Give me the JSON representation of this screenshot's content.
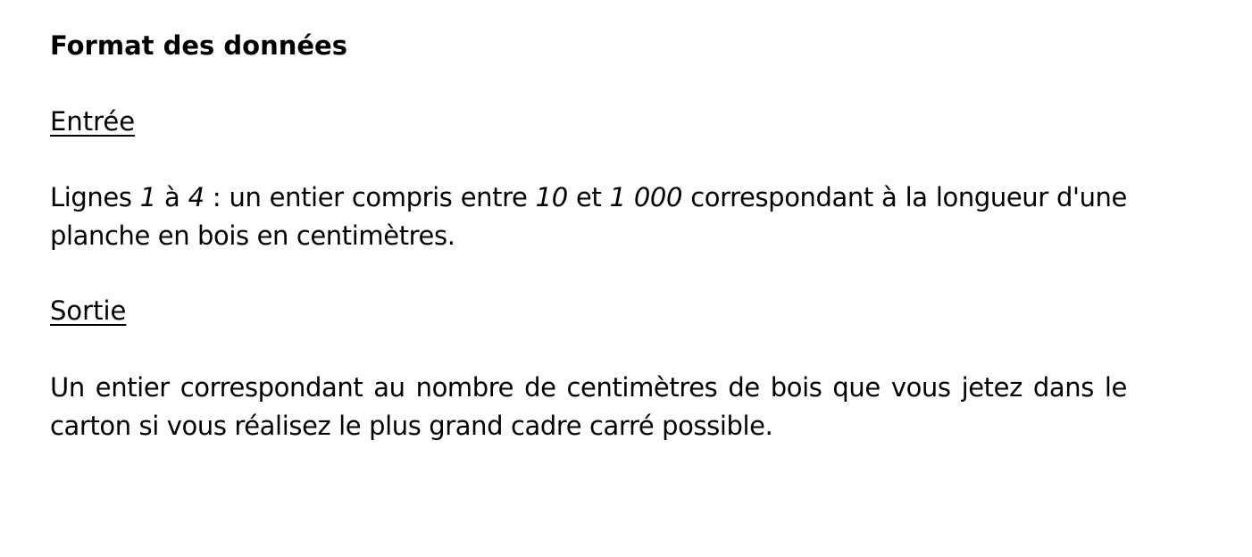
{
  "document": {
    "title": "Format des données",
    "input": {
      "heading": "Entrée",
      "text_1": "Lignes ",
      "num_1": "1",
      "text_2": " à ",
      "num_2": "4",
      "text_3": " : un entier compris entre ",
      "num_3": "10",
      "text_4": " et ",
      "num_4": "1 000",
      "text_5": " correspondant à la longueur d'une planche en bois en centimètres."
    },
    "output": {
      "heading": "Sortie",
      "text": "Un entier correspondant au nombre de centimètres de bois que vous jetez dans le carton si vous réalisez le plus grand cadre carré possible."
    }
  }
}
